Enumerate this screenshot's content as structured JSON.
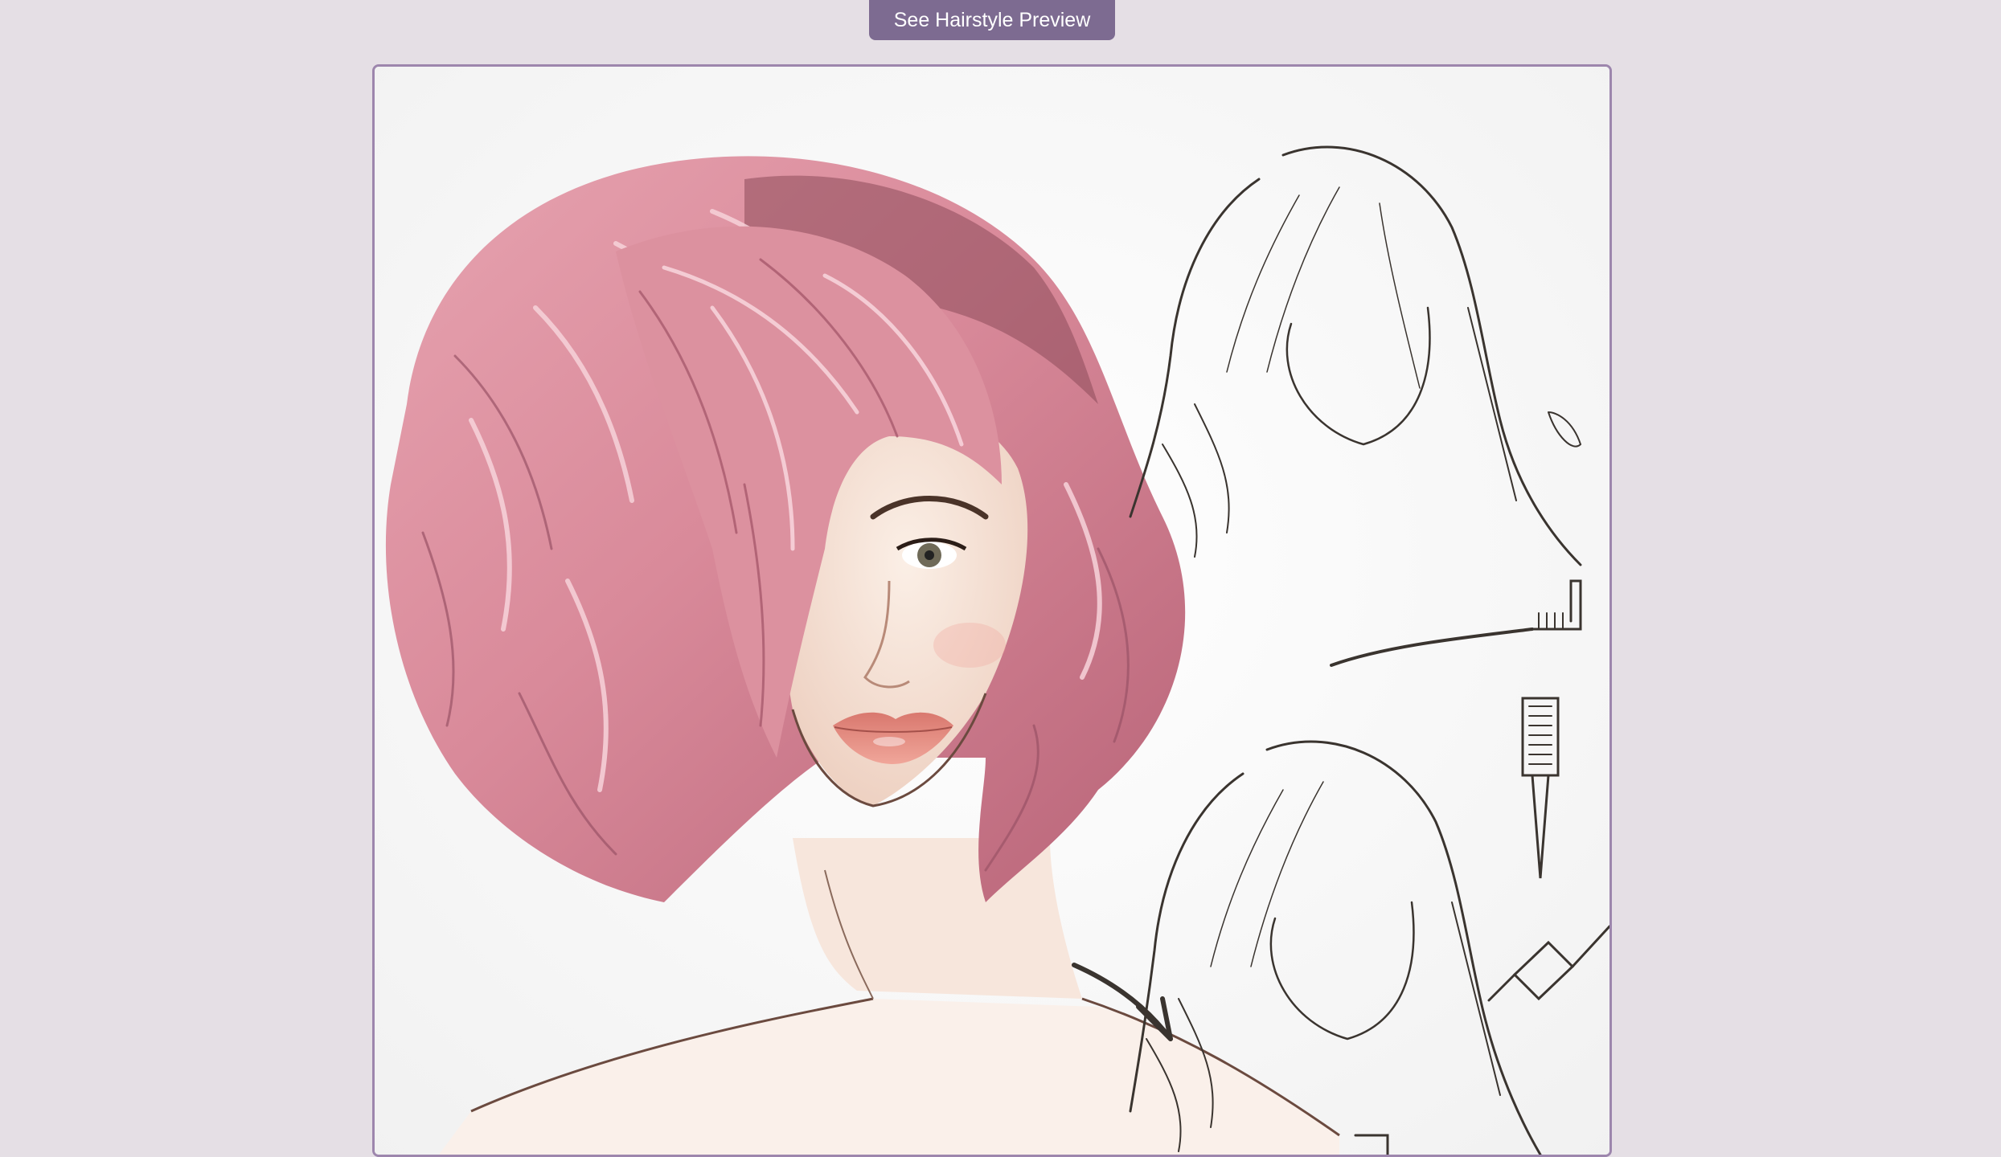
{
  "preview_button": {
    "label": "See Hairstyle Preview"
  },
  "illustration": {
    "icon": "hairstyle-illustration",
    "colors": {
      "frame_border": "#9d86ad",
      "button": "#7d6b91",
      "background": "#e5dfe5",
      "hair_pink": "#d98a9a",
      "hair_shadow": "#8c4a5a",
      "skin": "#f6e3d6",
      "lips": "#d9786e",
      "sketch_ink": "#3a342f"
    }
  }
}
